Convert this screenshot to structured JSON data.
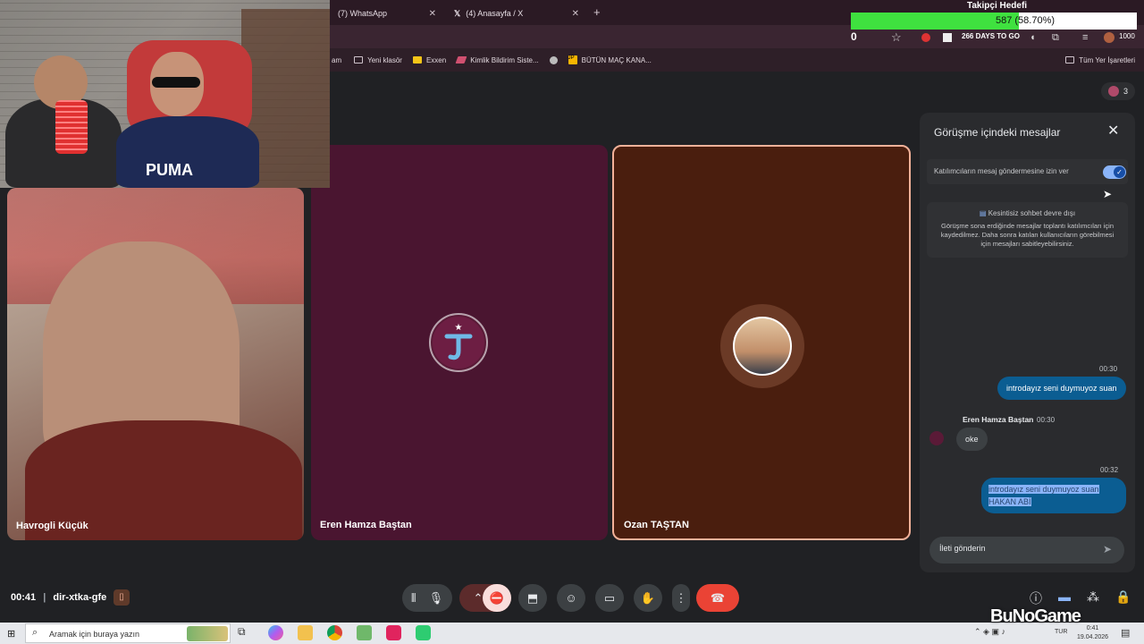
{
  "browser": {
    "tabs": [
      {
        "label": "(7) WhatsApp"
      },
      {
        "label": "(4) Anasayfa / X"
      }
    ],
    "bookmarks": [
      "Yeni klasör",
      "Exxen",
      "Kimlik Bildirim Siste...",
      "BÜTÜN MAÇ KANA..."
    ],
    "bookmarks_right": "Tüm Yer İşaretleri",
    "bookmark_partial": "am"
  },
  "overlay": {
    "goal_title": "Takipçi Hedefi",
    "goal_text": "587 (58.70%)",
    "goal_percent": 58.7,
    "zero_count": "0",
    "days_badge": "266 DAYS TO GO",
    "meter_count": "1000",
    "participants_count": "3"
  },
  "meet": {
    "participants": [
      {
        "name": "Havrogli Küçük"
      },
      {
        "name": "Eren Hamza Baştan"
      },
      {
        "name": "Ozan TAŞTAN"
      }
    ],
    "time": "00:41",
    "code": "dir-xtka-gfe"
  },
  "chat": {
    "title": "Görüşme içindeki mesajlar",
    "allow_label": "Katılımcıların mesaj göndermesine izin ver",
    "allow_enabled": true,
    "info_title": "Kesintisiz sohbet devre dışı",
    "info_body": "Görüşme sona erdiğinde mesajlar toplantı katılımcıları için kaydedilmez. Daha sonra katılan kullanıcıların görebilmesi için mesajları sabitleyebilirsiniz.",
    "messages": [
      {
        "time": "00:30",
        "text": "introdayız seni duymuyoz suan"
      },
      {
        "sender": "Eren Hamza Baştan",
        "time": "00:30",
        "text": "oke"
      },
      {
        "time": "00:32",
        "line1": "introdayız seni duymuyoz suan",
        "line2": "HAKAN ABİ"
      }
    ],
    "input_placeholder": "İleti gönderin"
  },
  "taskbar": {
    "search_placeholder": "Aramak için buraya yazın",
    "lang": "TUR",
    "clock": "0:41",
    "date": "19.04.2026"
  },
  "watermark": "BuNoGame",
  "colors": {
    "accent": "#8ab4f8",
    "end_call": "#ea4335",
    "goal_fill": "#3fe13f",
    "active_border": "#f3b199"
  }
}
